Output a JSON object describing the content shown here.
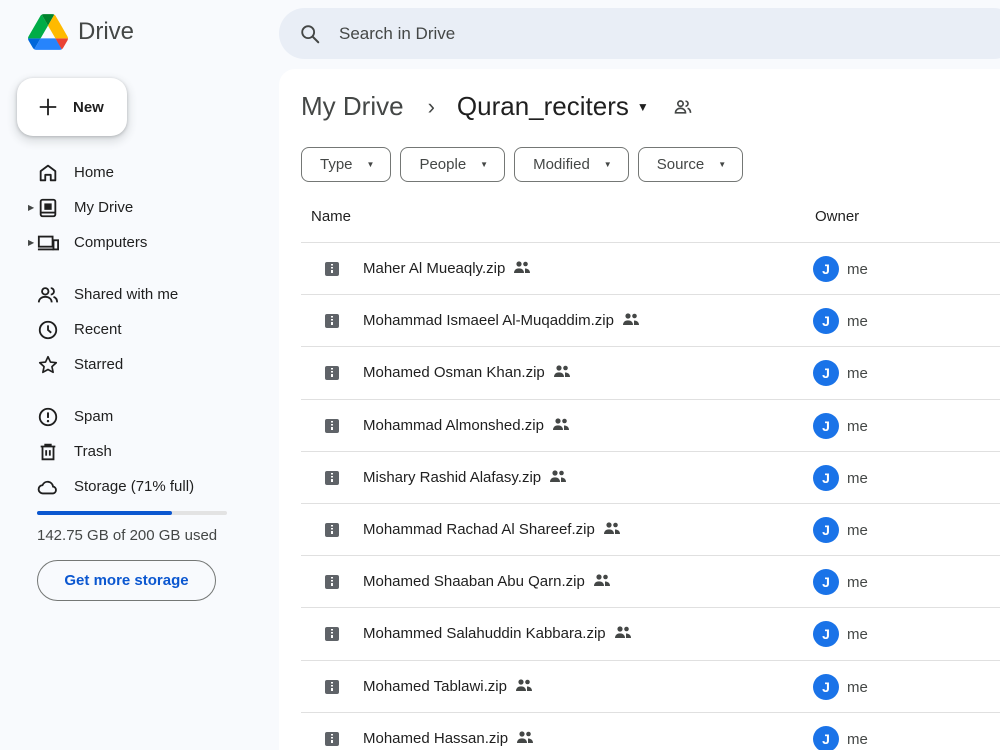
{
  "app": {
    "name": "Drive"
  },
  "search": {
    "placeholder": "Search in Drive"
  },
  "sidebar": {
    "new_label": "New",
    "items": [
      {
        "label": "Home",
        "icon": "home-icon"
      },
      {
        "label": "My Drive",
        "icon": "my-drive-icon",
        "expandable": true
      },
      {
        "label": "Computers",
        "icon": "computers-icon",
        "expandable": true
      },
      {
        "label": "Shared with me",
        "icon": "shared-with-me-icon"
      },
      {
        "label": "Recent",
        "icon": "clock-icon"
      },
      {
        "label": "Starred",
        "icon": "star-icon"
      },
      {
        "label": "Spam",
        "icon": "spam-icon"
      },
      {
        "label": "Trash",
        "icon": "trash-icon"
      },
      {
        "label": "Storage (71% full)",
        "icon": "cloud-icon"
      }
    ],
    "storage": {
      "used_text": "142.75 GB of 200 GB used",
      "fraction": 0.71,
      "cta": "Get more storage"
    }
  },
  "breadcrumb": {
    "root": "My Drive",
    "separator": "›",
    "current": "Quran_reciters"
  },
  "filters": [
    "Type",
    "People",
    "Modified",
    "Source"
  ],
  "table": {
    "headers": {
      "name": "Name",
      "owner": "Owner"
    },
    "rows": [
      {
        "name": "Maher Al Mueaqly.zip",
        "owner": "me",
        "avatar": "J"
      },
      {
        "name": "Mohammad Ismaeel Al-Muqaddim.zip",
        "owner": "me",
        "avatar": "J"
      },
      {
        "name": "Mohamed Osman Khan.zip",
        "owner": "me",
        "avatar": "J"
      },
      {
        "name": "Mohammad Almonshed.zip",
        "owner": "me",
        "avatar": "J"
      },
      {
        "name": "Mishary Rashid Alafasy.zip",
        "owner": "me",
        "avatar": "J"
      },
      {
        "name": "Mohammad Rachad Al Shareef.zip",
        "owner": "me",
        "avatar": "J"
      },
      {
        "name": "Mohamed Shaaban Abu Qarn.zip",
        "owner": "me",
        "avatar": "J"
      },
      {
        "name": "Mohammed Salahuddin Kabbara.zip",
        "owner": "me",
        "avatar": "J"
      },
      {
        "name": "Mohamed Tablawi.zip",
        "owner": "me",
        "avatar": "J"
      },
      {
        "name": "Mohamed Hassan.zip",
        "owner": "me",
        "avatar": "J"
      }
    ]
  },
  "colors": {
    "accent": "#0b57d0",
    "avatar": "#1a73e8",
    "search_bg": "#e9eef6",
    "page_bg": "#f8fafd"
  }
}
